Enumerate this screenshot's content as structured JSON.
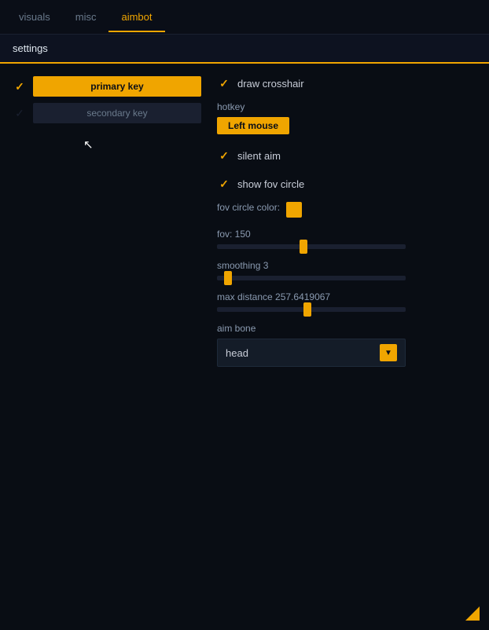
{
  "nav": {
    "tabs": [
      {
        "id": "visuals",
        "label": "visuals",
        "active": false
      },
      {
        "id": "misc",
        "label": "misc",
        "active": false
      },
      {
        "id": "aimbot",
        "label": "aimbot",
        "active": true
      }
    ]
  },
  "settings_bar": {
    "label": "settings"
  },
  "left_panel": {
    "primary_key": {
      "checked": true,
      "label": "primary key"
    },
    "secondary_key": {
      "checked": false,
      "label": "secondary key"
    }
  },
  "right_panel": {
    "draw_crosshair": {
      "checked": true,
      "label": "draw crosshair"
    },
    "hotkey": {
      "label": "hotkey",
      "value": "Left mouse"
    },
    "silent_aim": {
      "checked": true,
      "label": "silent aim"
    },
    "show_fov_circle": {
      "checked": true,
      "label": "show fov circle"
    },
    "fov_circle_color": {
      "label": "fov circle color:",
      "color": "#f0a500"
    },
    "fov": {
      "label": "fov: 150",
      "value": 150,
      "max": 300,
      "thumb_pct": 46
    },
    "smoothing": {
      "label": "smoothing 3",
      "value": 3,
      "max": 20,
      "thumb_pct": 6
    },
    "max_distance": {
      "label": "max distance 257.6419067",
      "value": 257.6419067,
      "max": 600,
      "thumb_pct": 48
    },
    "aim_bone": {
      "label": "aim bone",
      "dropdown_value": "head",
      "dropdown_arrow": "▼"
    }
  },
  "corner": {
    "visible": true
  }
}
